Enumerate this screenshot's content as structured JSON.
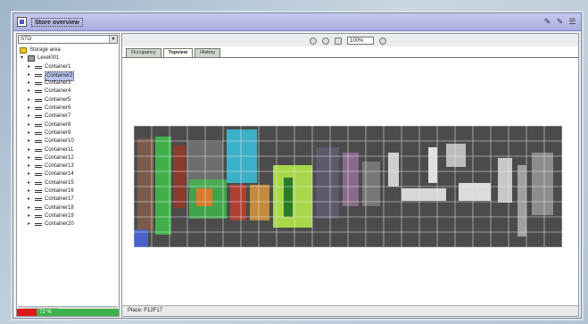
{
  "window": {
    "title": "Store overview",
    "buttons": [
      "✎",
      "✎",
      "☰"
    ]
  },
  "tree": {
    "combo_value": "STO",
    "root": "Storage area",
    "node": "Level001",
    "items": [
      "Container1",
      "Container2",
      "Container3",
      "Container4",
      "Container5",
      "Container6",
      "Container7",
      "Container8",
      "Container9",
      "Container10",
      "Container11",
      "Container12",
      "Container13",
      "Container14",
      "Container15",
      "Container16",
      "Container17",
      "Container18",
      "Container19",
      "Container20"
    ],
    "selected_index": 1,
    "status_text": "72 %",
    "status_progress": 0.72
  },
  "toolbar": {
    "zoom_value": "100%"
  },
  "tabs": [
    {
      "label": "Occupancy",
      "active": false
    },
    {
      "label": "Topview",
      "active": true
    },
    {
      "label": "History",
      "active": false
    }
  ],
  "status": {
    "text": "Place: F12F17"
  },
  "colors": {
    "title_bar": "#b8bce8",
    "zone_green": "#3fc24a",
    "zone_cyan": "#39c2dc",
    "zone_lime": "#b8f04a",
    "zone_blue": "#4a64d8",
    "status_red": "#e01818",
    "status_green": "#3ab14a"
  }
}
